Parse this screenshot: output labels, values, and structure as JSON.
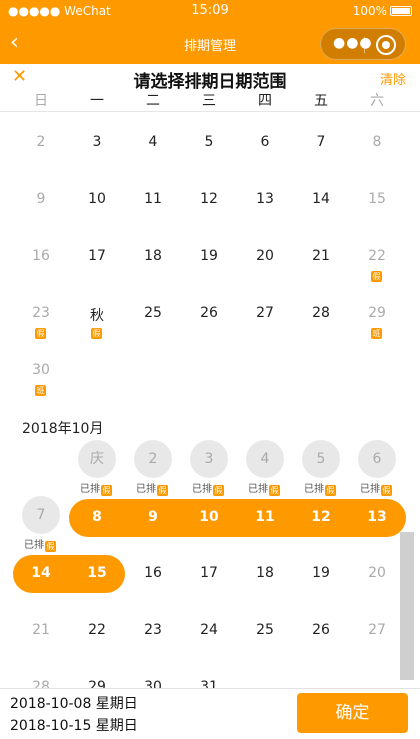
{
  "status_bar": {
    "carrier": "●●●●● WeChat",
    "time": "15:09",
    "battery": "100%"
  },
  "nav": {
    "back_icon": "‹",
    "title": "排期管理",
    "more_icon": "●●●"
  },
  "sheet": {
    "close_icon": "✕",
    "title": "请选择排期日期范围",
    "clear_label": "清除",
    "weekdays": [
      "日",
      "一",
      "二",
      "三",
      "四",
      "五",
      "六"
    ]
  },
  "colors": {
    "accent": "#ff9900",
    "gray_text": "#aaaaaa",
    "disabled_circle": "#e8e8e8"
  },
  "september": {
    "rows": [
      [
        {
          "d": "2",
          "gray": true
        },
        {
          "d": "3"
        },
        {
          "d": "4"
        },
        {
          "d": "5"
        },
        {
          "d": "6"
        },
        {
          "d": "7"
        },
        {
          "d": "8",
          "gray": true
        }
      ],
      [
        {
          "d": "9",
          "gray": true
        },
        {
          "d": "10"
        },
        {
          "d": "11"
        },
        {
          "d": "12"
        },
        {
          "d": "13"
        },
        {
          "d": "14"
        },
        {
          "d": "15",
          "gray": true
        }
      ],
      [
        {
          "d": "16",
          "gray": true
        },
        {
          "d": "17"
        },
        {
          "d": "18"
        },
        {
          "d": "19"
        },
        {
          "d": "20"
        },
        {
          "d": "21"
        },
        {
          "d": "22",
          "gray": true,
          "badge": "假"
        }
      ],
      [
        {
          "d": "23",
          "gray": true,
          "badge": "假"
        },
        {
          "d": "秋",
          "badge": "假"
        },
        {
          "d": "25"
        },
        {
          "d": "26"
        },
        {
          "d": "27"
        },
        {
          "d": "28"
        },
        {
          "d": "29",
          "gray": true,
          "badge": "班"
        }
      ],
      [
        {
          "d": "30",
          "gray": true,
          "badge": "班"
        }
      ]
    ]
  },
  "october": {
    "label": "2018年10月",
    "scheduled_label": "已排",
    "scheduled_badge": "假",
    "scheduled_days": [
      "庆",
      "2",
      "3",
      "4",
      "5",
      "6",
      "7"
    ],
    "selected_week1": [
      "8",
      "9",
      "10",
      "11",
      "12",
      "13"
    ],
    "selected_week2": [
      "14",
      "15"
    ],
    "rows_after": [
      [
        {
          "d": "16"
        },
        {
          "d": "17"
        },
        {
          "d": "18"
        },
        {
          "d": "19"
        },
        {
          "d": "20",
          "gray": true
        }
      ],
      [
        {
          "d": "21",
          "gray": true
        },
        {
          "d": "22"
        },
        {
          "d": "23"
        },
        {
          "d": "24"
        },
        {
          "d": "25"
        },
        {
          "d": "26"
        },
        {
          "d": "27",
          "gray": true
        }
      ],
      [
        {
          "d": "28",
          "gray": true
        },
        {
          "d": "29"
        },
        {
          "d": "30"
        },
        {
          "d": "31"
        }
      ]
    ]
  },
  "footer": {
    "start": "2018-10-08 星期日",
    "end": "2018-10-15 星期日",
    "confirm_label": "确定"
  }
}
